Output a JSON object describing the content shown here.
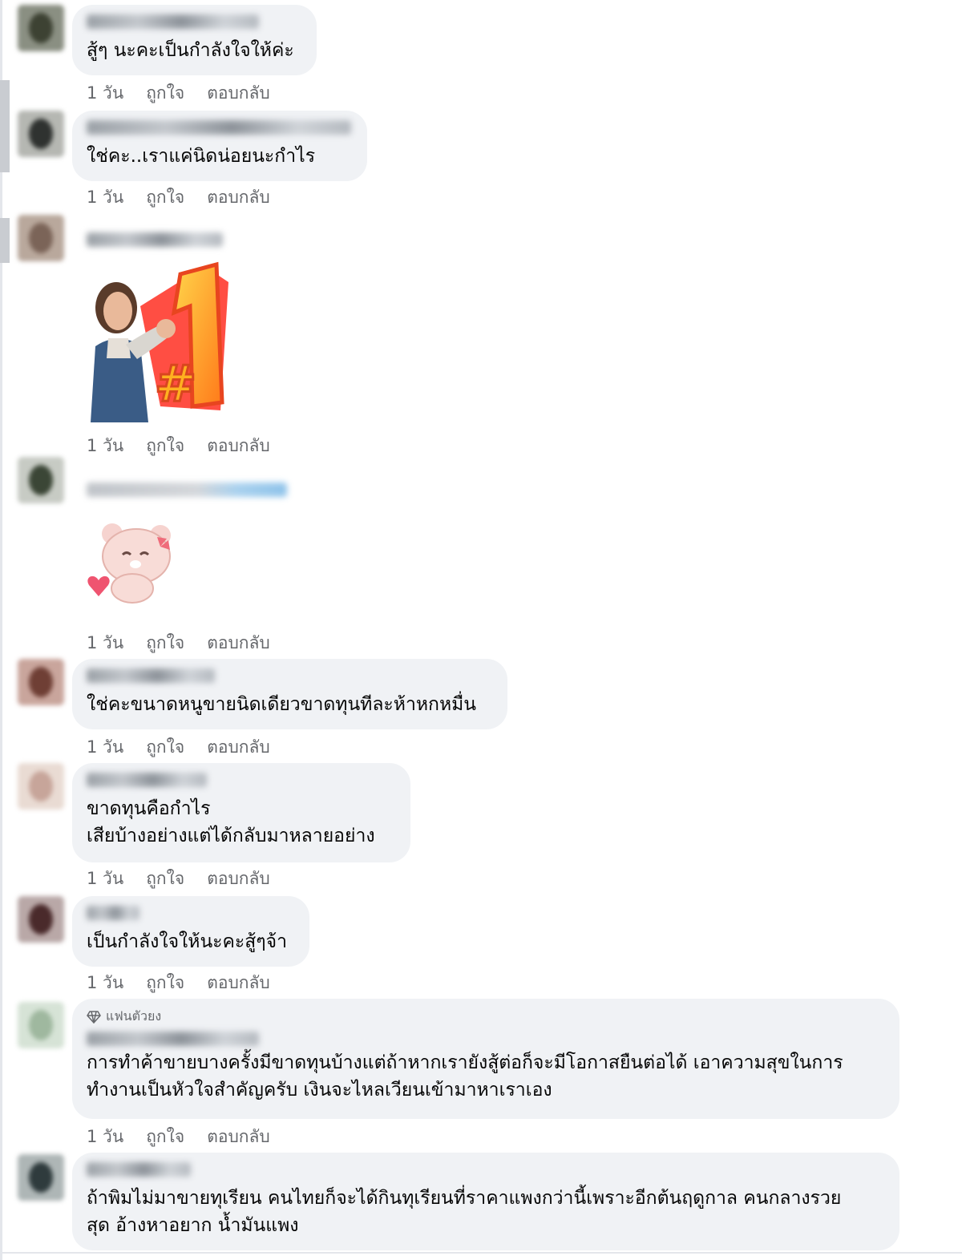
{
  "actions": {
    "time": "1 วัน",
    "like": "ถูกใจ",
    "reply": "ตอบกลับ"
  },
  "comments": [
    {
      "text": "สู้ๆ นะคะเป็นกำลังใจให้ค่ะ"
    },
    {
      "text": "ใช่คะ..เราแค่นิดน่อยนะกำไร"
    },
    {
      "text": "",
      "sticker": "thumbs-up-number-one-sticker"
    },
    {
      "text": "",
      "sticker": "pink-bear-heart-sticker"
    },
    {
      "text": "ใช่คะขนาดหนูขายนิดเดียวขาดทุนทีละห้าหกหมื่น"
    },
    {
      "text": "ขาดทุนคือกำไร\nเสียบ้างอย่างแต่ได้กลับมาหลายอย่าง"
    },
    {
      "text": "เป็นกำลังใจให้นะคะสู้ๆจ้า"
    },
    {
      "badge": "แฟนตัวยง",
      "text": "การทำค้าขายบางครั้งมีขาดทุนบ้างแต่ถ้าหากเรายังสู้ต่อก็จะมีโอกาสยืนต่อได้ เอาความสุขในการ\nทำงานเป็นหัวใจสำคัญครับ เงินจะไหลเวียนเข้ามาหาเราเอง"
    },
    {
      "text": "ถ้าพิมไม่มาขายทุเรียน คนไทยก็จะได้กินทุเรียนที่ราคาแพงกว่านี้เพราะอีกต้นฤดูกาล คนกลางรวย\nสุด อ้างหาอยาก น้ำมันแพง"
    }
  ],
  "colors": {
    "bubble": "#f0f2f5",
    "meta": "#65676b",
    "text": "#050505"
  }
}
